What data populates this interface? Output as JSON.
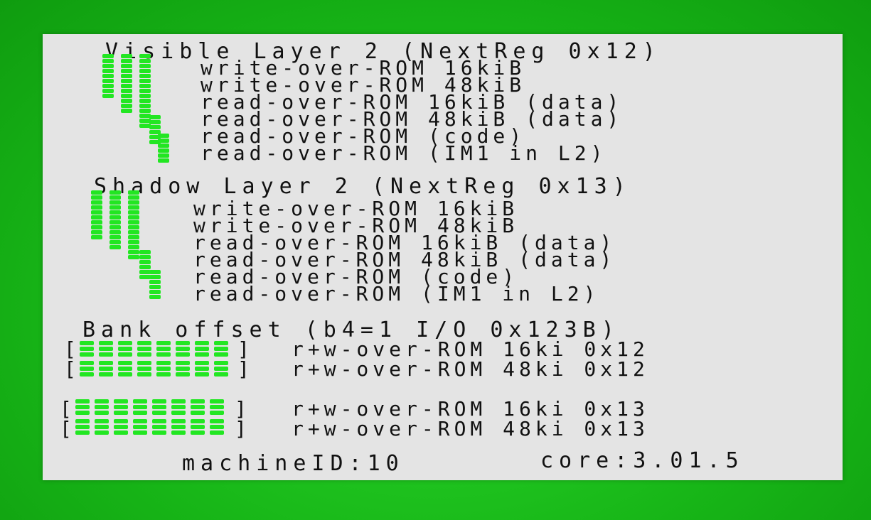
{
  "colors": {
    "background": "#1fbf1f",
    "screen": "#e4e4e4",
    "indicator": "#22e622",
    "text": "#111111"
  },
  "visible_layer": {
    "title": "Visible Layer 2 (NextReg 0x12)",
    "options": [
      "write-over-ROM 16kiB",
      "write-over-ROM 48kiB",
      "read-over-ROM 16kiB (data)",
      "read-over-ROM 48kiB (data)",
      "read-over-ROM (code)",
      "read-over-ROM (IM1 in L2)"
    ]
  },
  "shadow_layer": {
    "title": "Shadow Layer 2 (NextReg 0x13)",
    "options": [
      "write-over-ROM 16kiB",
      "write-over-ROM 48kiB",
      "read-over-ROM 16kiB (data)",
      "read-over-ROM 48kiB (data)",
      "read-over-ROM (code)",
      "read-over-ROM (IM1 in L2)"
    ]
  },
  "bank_offset": {
    "title": "Bank offset (b4=1 I/O 0x123B)",
    "rows": [
      {
        "label": "r+w-over-ROM 16ki 0x12"
      },
      {
        "label": "r+w-over-ROM 48ki 0x12"
      },
      {
        "label": "r+w-over-ROM 16ki 0x13"
      },
      {
        "label": "r+w-over-ROM 48ki 0x13"
      }
    ],
    "bracket_open": "[",
    "bracket_close": "]"
  },
  "status": {
    "machine": "machineID:10",
    "core": "core:3.01.5"
  }
}
